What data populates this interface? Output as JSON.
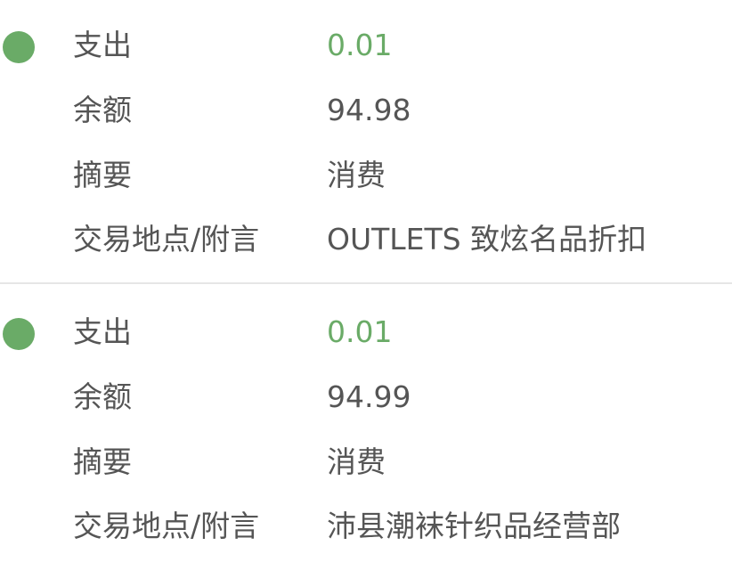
{
  "colors": {
    "status_dot": "#6aab67",
    "amount_text": "#6aab67",
    "label_text": "#555555",
    "divider": "#e6e6e6"
  },
  "records": [
    {
      "type_label": "支出",
      "amount": "0.01",
      "balance_label": "余额",
      "balance": "94.98",
      "summary_label": "摘要",
      "summary": "消费",
      "place_label": "交易地点/附言",
      "place": "OUTLETS 致炫名品折扣"
    },
    {
      "type_label": "支出",
      "amount": "0.01",
      "balance_label": "余额",
      "balance": "94.99",
      "summary_label": "摘要",
      "summary": "消费",
      "place_label": "交易地点/附言",
      "place": "沛县潮袜针织品经营部"
    }
  ]
}
